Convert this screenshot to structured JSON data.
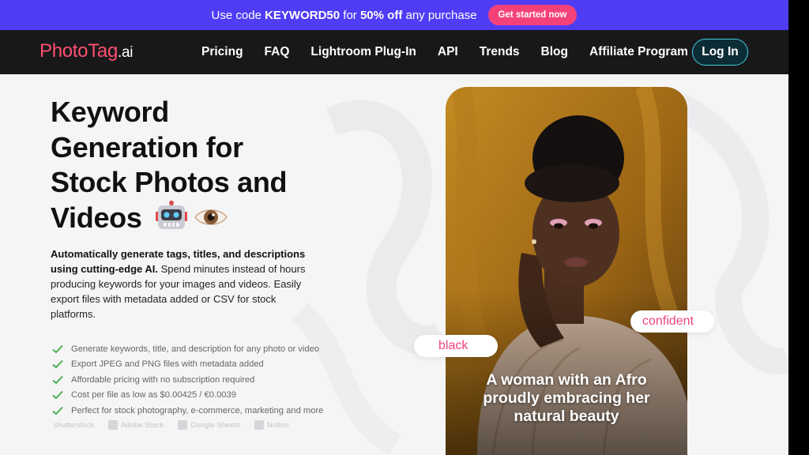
{
  "promo": {
    "text_prefix": "Use code ",
    "code": "KEYWORD50",
    "text_mid": " for ",
    "discount": "50% off",
    "text_suffix": " any purchase",
    "button": "Get started now"
  },
  "nav": {
    "logo_main": "PhotoTag",
    "logo_suffix": ".ai",
    "links": [
      "Pricing",
      "FAQ",
      "Lightroom Plug-In",
      "API",
      "Trends",
      "Blog",
      "Affiliate Program"
    ],
    "login": "Log In"
  },
  "hero": {
    "title_lines": [
      "Keyword",
      "Generation for",
      "Stock Photos and",
      "Videos"
    ],
    "emoji": [
      "robot-face",
      "eye"
    ],
    "desc_bold": "Automatically generate tags, titles, and descriptions using cutting-edge AI.",
    "desc_rest": " Spend minutes instead of hours producing keywords for your images and videos. Easily export files with metadata added or CSV for stock platforms.",
    "features": [
      "Generate keywords, title, and description for any photo or video",
      "Export JPEG and PNG files with metadata added",
      "Affordable pricing with no subscription required",
      "Cost per file as low as $0.00425 / €0.0039",
      "Perfect for stock photography, e-commerce, marketing and more"
    ],
    "partners": [
      "shutterstock",
      "Adobe Stock",
      "Google Sheets",
      "Notion"
    ]
  },
  "photo": {
    "tags": [
      "black",
      "confident"
    ],
    "caption_lines": [
      "A woman with an Afro",
      "proudly embracing her",
      "natural beauty"
    ]
  },
  "colors": {
    "promo_bg": "#4f3df5",
    "accent_pink": "#f5417a",
    "nav_bg": "#18181b",
    "login_border": "#3fd0e0",
    "check_green": "#4caf50"
  }
}
